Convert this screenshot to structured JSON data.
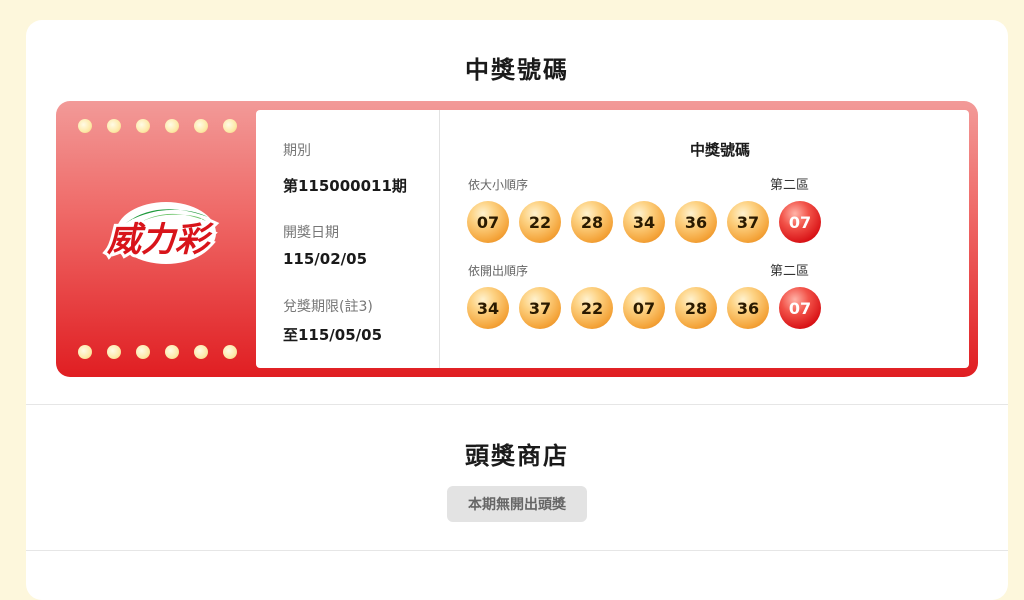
{
  "page": {
    "section1_title": "中獎號碼",
    "section2_title": "頭獎商店"
  },
  "ticket": {
    "logo_text": "威力彩",
    "period_label": "期別",
    "period_value": "第115000011期",
    "draw_date_label": "開獎日期",
    "draw_date_value": "115/02/05",
    "deadline_label": "兌獎期限(註3)",
    "deadline_value": "至115/05/05",
    "numbers_title": "中獎號碼",
    "by_size_label": "依大小順序",
    "by_draw_label": "依開出順序",
    "zone2_label": "第二區",
    "by_size_numbers": [
      "07",
      "22",
      "28",
      "34",
      "36",
      "37"
    ],
    "by_size_second": "07",
    "by_draw_numbers": [
      "34",
      "37",
      "22",
      "07",
      "28",
      "36"
    ],
    "by_draw_second": "07"
  },
  "shop": {
    "no_prize_label": "本期無開出頭獎"
  },
  "colors": {
    "background": "#fdf7dc",
    "ticket_red": "#e01e22",
    "ball_orange": "#f4a43a",
    "ball_red": "#d81216"
  }
}
